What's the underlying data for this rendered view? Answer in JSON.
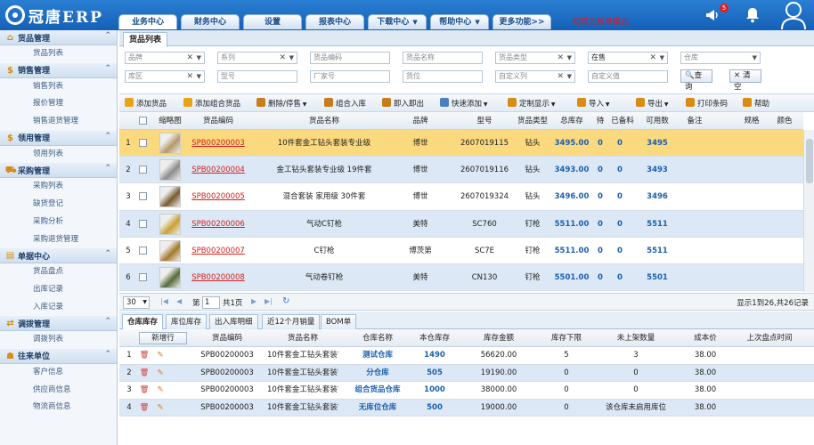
{
  "app": {
    "logo_text": "冠唐ERP",
    "notification_count": "5"
  },
  "nav": {
    "tabs": [
      {
        "label": "业务中心",
        "caret": false
      },
      {
        "label": "财务中心",
        "caret": false
      },
      {
        "label": "设置",
        "caret": false
      },
      {
        "label": "报表中心",
        "caret": false
      },
      {
        "label": "下载中心",
        "caret": true
      },
      {
        "label": "帮助中心",
        "caret": true
      },
      {
        "label": "更多功能>>",
        "caret": false
      }
    ],
    "note": "切换为标准模式"
  },
  "sidebar": {
    "groups": [
      {
        "label": "货品管理",
        "icon": "home-icon",
        "items": [
          "货品列表"
        ]
      },
      {
        "label": "销售管理",
        "icon": "dollar-icon",
        "items": [
          "销售列表",
          "报价管理",
          "销售退货管理"
        ]
      },
      {
        "label": "领用管理",
        "icon": "dollar-icon",
        "items": [
          "领用列表"
        ]
      },
      {
        "label": "采购管理",
        "icon": "truck-icon",
        "items": [
          "采购列表",
          "缺货登记",
          "采购分析",
          "采购退货管理"
        ]
      },
      {
        "label": "单据中心",
        "icon": "document-icon",
        "items": [
          "货品盘点",
          "出库记录",
          "入库记录"
        ]
      },
      {
        "label": "调拨管理",
        "icon": "transfer-icon",
        "items": [
          "调拨列表"
        ]
      },
      {
        "label": "往来单位",
        "icon": "user-icon",
        "items": [
          "客户信息",
          "供应商信息",
          "物流商信息"
        ]
      }
    ]
  },
  "main": {
    "tab": "货品列表",
    "filters": {
      "brand": "品牌",
      "series": "系列",
      "code": "货品编码",
      "name": "货品名称",
      "type": "货品类型",
      "status": "在售",
      "warehouse": "仓库",
      "area": "库区",
      "model": "型号",
      "vendor": "厂家号",
      "location": "货位",
      "custom1": "自定义列",
      "custom2": "自定义值",
      "query_btn": "查询",
      "clear_btn": "清空"
    },
    "toolbar": [
      {
        "label": "添加货品",
        "icon": "plus-icon",
        "color": "#e8a317"
      },
      {
        "label": "添加组合货品",
        "icon": "combo-icon",
        "color": "#e8a317"
      },
      {
        "label": "删除/停售",
        "icon": "trash-icon",
        "color": "#c77d1a",
        "caret": true
      },
      {
        "label": "组合入库",
        "icon": "stock-in-icon",
        "color": "#c77d1a"
      },
      {
        "label": "即入即出",
        "icon": "inout-icon",
        "color": "#c77d1a"
      },
      {
        "label": "快速添加",
        "icon": "quick-add-icon",
        "color": "#4a7fc1",
        "caret": true
      },
      {
        "label": "定制显示",
        "icon": "settings-icon",
        "color": "#d98b12",
        "caret": true
      },
      {
        "label": "导入",
        "icon": "import-icon",
        "color": "#d98b12",
        "caret": true
      },
      {
        "label": "导出",
        "icon": "export-icon",
        "color": "#d98b12",
        "caret": true
      },
      {
        "label": "打印条码",
        "icon": "print-icon",
        "color": "#d98b12"
      },
      {
        "label": "帮助",
        "icon": "help-icon",
        "color": "#d98b12"
      }
    ],
    "columns": [
      "缩略图",
      "货品编码",
      "货品名称",
      "品牌",
      "型号",
      "货品类型",
      "总库存",
      "待",
      "已备料",
      "可用数",
      "备注",
      "规格",
      "颜色"
    ],
    "rows": [
      {
        "no": "1",
        "code": "SPB00200003",
        "name": "10件套金工钻头套装专业级",
        "brand": "博世",
        "model": "2607019115",
        "type": "钻头",
        "total": "3495.00",
        "pending": "0",
        "prepared": "0",
        "available": "3495"
      },
      {
        "no": "2",
        "code": "SPB00200004",
        "name": "金工钻头套装专业级 19件套",
        "brand": "博世",
        "model": "2607019116",
        "type": "钻头",
        "total": "3493.00",
        "pending": "0",
        "prepared": "0",
        "available": "3493"
      },
      {
        "no": "3",
        "code": "SPB00200005",
        "name": "混合套装 家用级 30件套",
        "brand": "博世",
        "model": "2607019324",
        "type": "钻头",
        "total": "3496.00",
        "pending": "0",
        "prepared": "0",
        "available": "3496"
      },
      {
        "no": "4",
        "code": "SPB00200006",
        "name": "气动C钉枪",
        "brand": "美特",
        "model": "SC760",
        "type": "钉枪",
        "total": "5511.00",
        "pending": "0",
        "prepared": "0",
        "available": "5511"
      },
      {
        "no": "5",
        "code": "SPB00200007",
        "name": "C钉枪",
        "brand": "博茨第",
        "model": "SC7E",
        "type": "钉枪",
        "total": "5511.00",
        "pending": "0",
        "prepared": "0",
        "available": "5511"
      },
      {
        "no": "6",
        "code": "SPB00200008",
        "name": "气动卷钉枪",
        "brand": "美特",
        "model": "CN130",
        "type": "钉枪",
        "total": "5501.00",
        "pending": "0",
        "prepared": "0",
        "available": "5501"
      }
    ],
    "pager": {
      "page_size": "30",
      "page_prefix": "第",
      "page": "1",
      "page_suffix": "共1页",
      "summary": "显示1到26,共26记录"
    }
  },
  "bottom": {
    "tabs": [
      "仓库库存",
      "库位库存",
      "出入库明细",
      "近12个月销量",
      "BOM单"
    ],
    "new_row_btn": "新增行",
    "columns": [
      "货品编码",
      "货品名称",
      "仓库名称",
      "本仓库存",
      "库存金额",
      "库存下限",
      "未上架数量",
      "成本价",
      "上次盘点时间"
    ],
    "rows": [
      {
        "no": "1",
        "code": "SPB00200003",
        "name": "10件套金工钻头套装'",
        "warehouse": "测试仓库",
        "stock": "1490",
        "amount": "56620.00",
        "min": "5",
        "unshelved": "3",
        "cost": "38.00",
        "last": ""
      },
      {
        "no": "2",
        "code": "SPB00200003",
        "name": "10件套金工钻头套装'",
        "warehouse": "分仓库",
        "stock": "505",
        "amount": "19190.00",
        "min": "0",
        "unshelved": "0",
        "cost": "38.00",
        "last": ""
      },
      {
        "no": "3",
        "code": "SPB00200003",
        "name": "10件套金工钻头套装'",
        "warehouse": "组合货品仓库",
        "stock": "1000",
        "amount": "38000.00",
        "min": "0",
        "unshelved": "0",
        "cost": "38.00",
        "last": ""
      },
      {
        "no": "4",
        "code": "SPB00200003",
        "name": "10件套金工钻头套装'",
        "warehouse": "无库位仓库",
        "stock": "500",
        "amount": "19000.00",
        "min": "0",
        "unshelved": "该仓库未启用库位",
        "cost": "38.00",
        "last": ""
      }
    ]
  },
  "colors": {
    "accent": "#1a5fb0",
    "code_link": "#d32020",
    "selected_row": "#fbd97e",
    "alt_row": "#dce8f5"
  }
}
